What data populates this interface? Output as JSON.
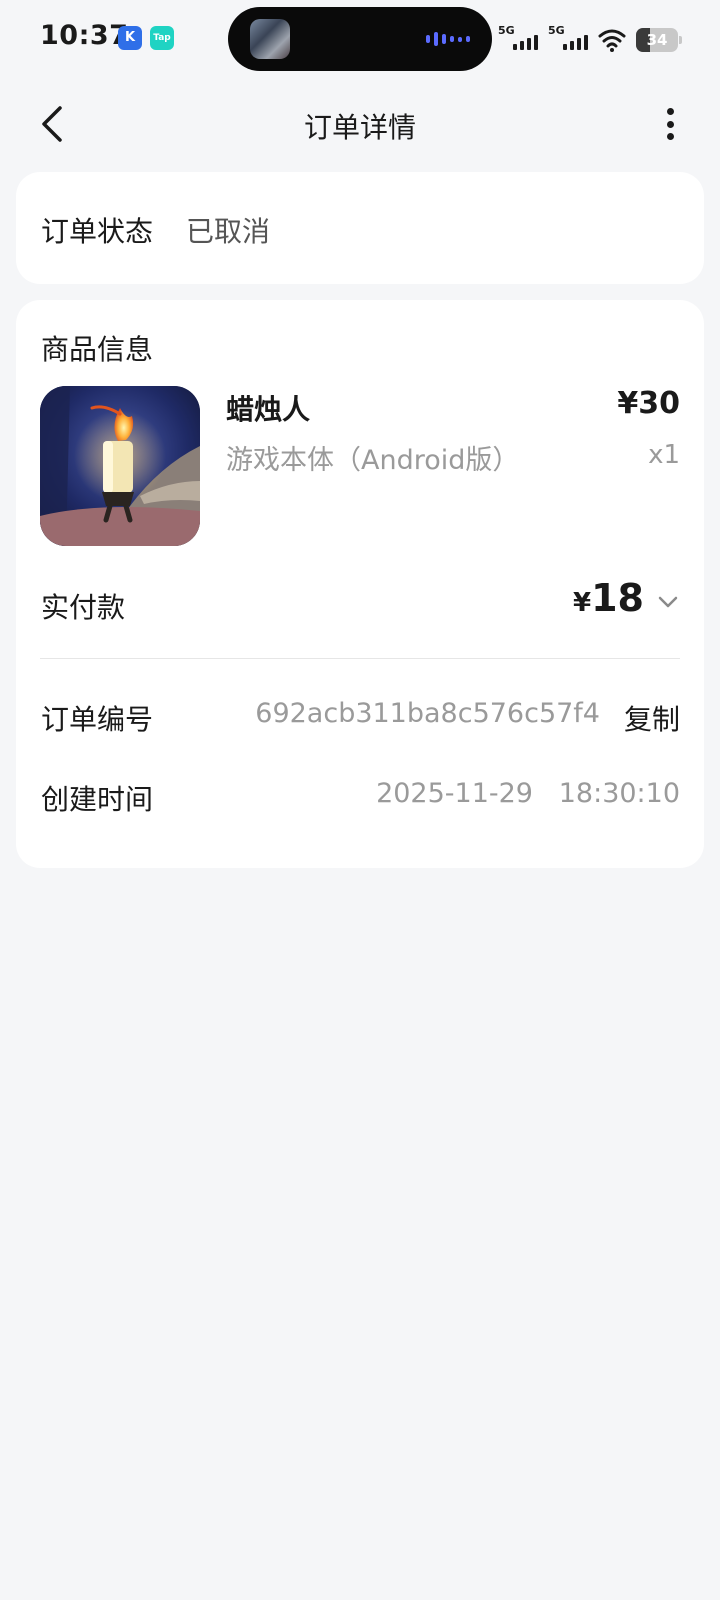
{
  "status_bar": {
    "time": "10:37",
    "app_icon_1": "K",
    "app_icon_2": "Tap",
    "signal_1_label": "5G",
    "signal_2_label": "5G",
    "battery_level": "34",
    "icons": [
      "k-app-icon",
      "taptap-icon",
      "signal-5g-icon",
      "signal-5g-icon",
      "wifi-icon",
      "battery-icon"
    ]
  },
  "nav": {
    "title": "订单详情",
    "back_icon": "chevron-left-icon",
    "more_icon": "more-vertical-icon"
  },
  "order_status": {
    "label": "订单状态",
    "value": "已取消"
  },
  "product_info": {
    "section_title": "商品信息",
    "product_name": "蜡烛人",
    "price": "¥30",
    "variant": "游戏本体（Android版）",
    "quantity": "x1"
  },
  "payment": {
    "label": "实付款",
    "currency": "¥",
    "amount": "18",
    "chevron_icon": "chevron-down-icon"
  },
  "order_number": {
    "label": "订单编号",
    "value": "692acb311ba8c576c57f4",
    "copy_label": "复制"
  },
  "created_time": {
    "label": "创建时间",
    "value": "2025-11-29   18:30:10"
  },
  "colors": {
    "background": "#f5f6f8",
    "card": "#ffffff",
    "primary_text": "#1a1a1a",
    "secondary_text": "#9a9a9a"
  }
}
